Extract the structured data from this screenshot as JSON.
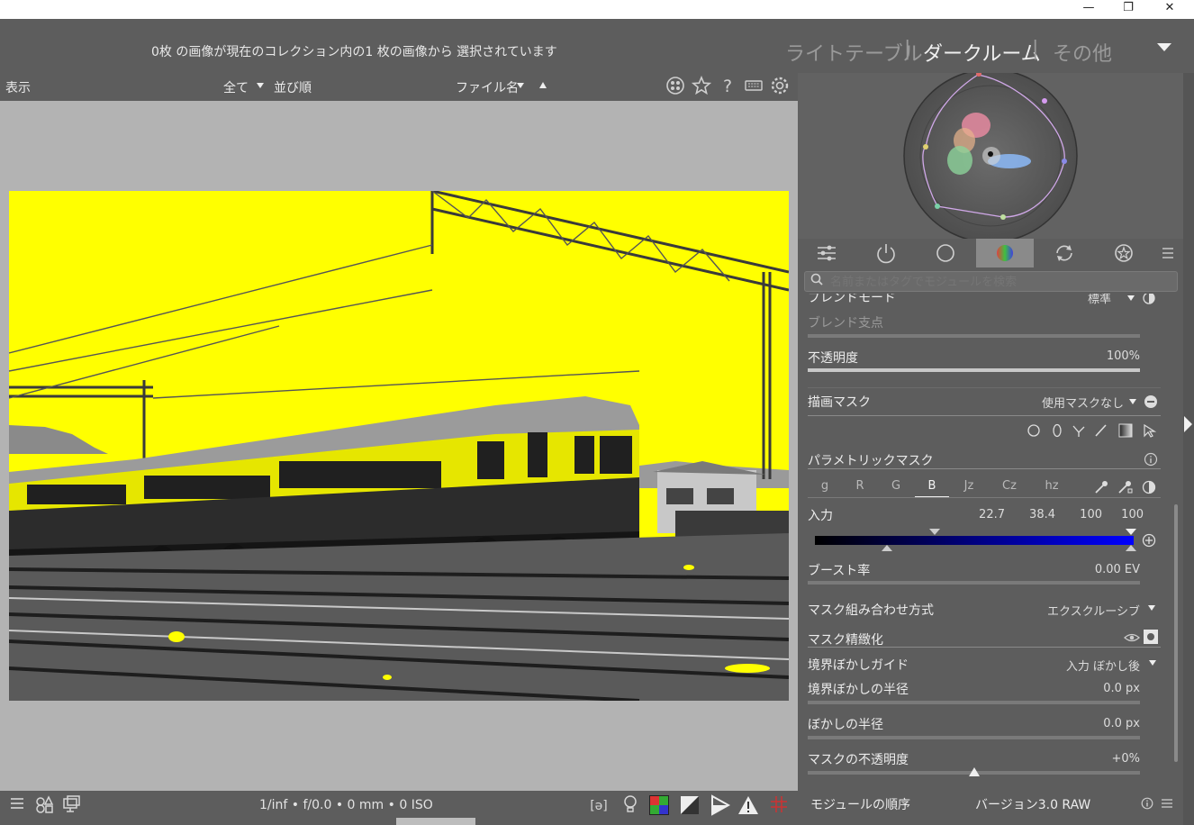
{
  "window": {
    "restore_glyph": "❐",
    "minimize_glyph": "—",
    "close_glyph": "✕"
  },
  "header": {
    "status": "0枚 の画像が現在のコレクション内の1 枚の画像から 選択されています",
    "views": [
      "ライトテーブル",
      "ダークルーム",
      "その他"
    ],
    "active_view": "ダークルーム",
    "separator": "|"
  },
  "filterbar": {
    "display_label": "表示",
    "filter_value": "全て",
    "sort_label": "並び順",
    "sort_value": "ファイル名",
    "icons": [
      "grouping-icon",
      "star-icon",
      "help-icon",
      "keyboard-icon",
      "gear-icon"
    ],
    "help_glyph": "?"
  },
  "scopes": {
    "type": "vectorscope"
  },
  "module_tabs": {
    "icons": [
      "quick-access-icon",
      "active-modules-icon",
      "base-modules-icon",
      "color-modules-icon",
      "correct-modules-icon",
      "effect-modules-icon",
      "presets-menu-icon"
    ],
    "active_index": 3
  },
  "search": {
    "placeholder": "名前またはタグでモジュールを検索"
  },
  "module": {
    "blend_mode_label": "ブレンドモード",
    "blend_mode_value": "標準",
    "blend_fulcrum_label": "ブレンド支点",
    "opacity_label": "不透明度",
    "opacity_value": "100%",
    "opacity_fraction": 1.0,
    "drawn_mask_label": "描画マスク",
    "drawn_mask_value": "使用マスクなし",
    "parametric_mask_label": "パラメトリックマスク",
    "channels": [
      "g",
      "R",
      "G",
      "B",
      "Jz",
      "Cz",
      "hz"
    ],
    "active_channel": "B",
    "input_label": "入力",
    "input_values": [
      "22.7",
      "38.4",
      "100",
      "100"
    ],
    "boost_label": "ブースト率",
    "boost_value": "0.00 EV",
    "combine_label": "マスク組み合わせ方式",
    "combine_value": "エクスクルーシブ",
    "refine_label": "マスク精緻化",
    "feather_guide_label": "境界ぼかしガイド",
    "feather_guide_value": "入力 ぼかし後",
    "feather_radius_label": "境界ぼかしの半径",
    "feather_radius_value": "0.0 px",
    "blur_radius_label": "ぼかしの半径",
    "blur_radius_value": "0.0 px",
    "mask_opacity_label": "マスクの不透明度",
    "mask_opacity_value": "+0%"
  },
  "footer": {
    "module_order_label": "モジュールの順序",
    "module_order_value": "バージョン3.0 RAW"
  },
  "bottombar": {
    "exif": "1/inf • f/0.0 • 0 mm • 0 ISO",
    "icons": [
      "filmstrip-menu-icon",
      "styles-icon",
      "second-window-icon",
      "focus-peaking-icon",
      "raw-overexposed-icon",
      "color-assessment-icon",
      "clipping-icon",
      "softproof-icon",
      "gamut-check-icon",
      "guides-icon"
    ]
  },
  "colors": {
    "panel_bg": "#5d5d5d",
    "center_bg": "#b3b3b3",
    "photo_highlight": "#ffff00",
    "mask_gradient_end": "#0000ff"
  }
}
